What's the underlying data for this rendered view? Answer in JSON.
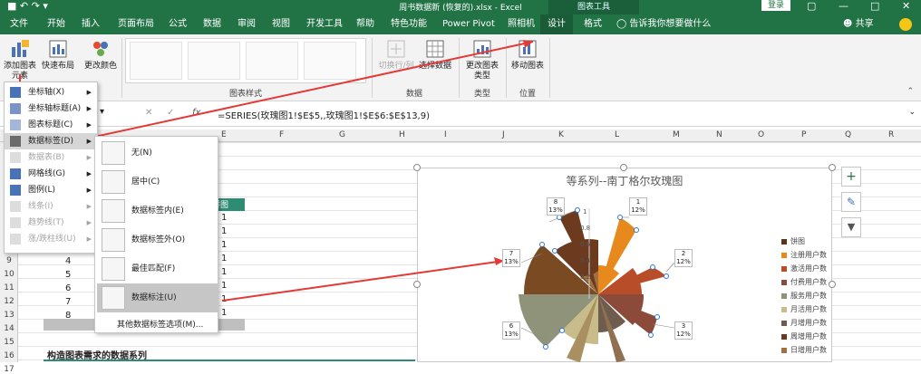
{
  "window": {
    "title": "周书数据新 (恢复的).xlsx - Excel",
    "context_tab": "图表工具",
    "login_label": "登录"
  },
  "menu_tabs": [
    "文件",
    "开始",
    "插入",
    "页面布局",
    "公式",
    "数据",
    "审阅",
    "视图",
    "开发工具",
    "帮助",
    "特色功能",
    "Power Pivot",
    "照相机",
    "设计",
    "格式"
  ],
  "active_tab": "设计",
  "tell_me": "告诉我你想要做什么",
  "share": "共享",
  "ribbon": {
    "add_element": "添加图表元素",
    "quick_layout": "快速布局",
    "change_colors": "更改颜色",
    "chart_styles_group": "图表样式",
    "switch_row_col": "切换行/列",
    "select_data": "选择数据",
    "data_group": "数据",
    "change_type": "更改图表类型",
    "type_group": "类型",
    "move_chart": "移动图表",
    "location_group": "位置"
  },
  "formula": {
    "fx": "fx",
    "text": "=SERIES(玫瑰图1!$E$5,,玫瑰图1!$E$6:$E$13,9)"
  },
  "columns": [
    "E",
    "F",
    "G",
    "H",
    "I",
    "J",
    "K",
    "L",
    "M",
    "N",
    "O",
    "P",
    "Q",
    "R"
  ],
  "rows": [
    "9",
    "10",
    "11",
    "12",
    "13",
    "14",
    "15",
    "16",
    "17"
  ],
  "cells": {
    "values": [
      "4",
      "5",
      "6",
      "7",
      "8"
    ],
    "ones": [
      "1",
      "1",
      "1",
      "1",
      "1",
      "1",
      "1",
      "1"
    ],
    "header_fragment": "饼图",
    "section_title": "构造图表需求的数据系列"
  },
  "add_element_menu": [
    {
      "label": "坐标轴(X)",
      "disabled": false
    },
    {
      "label": "坐标轴标题(A)",
      "disabled": false
    },
    {
      "label": "图表标题(C)",
      "disabled": false
    },
    {
      "label": "数据标签(D)",
      "disabled": false,
      "active": true
    },
    {
      "label": "数据表(B)",
      "disabled": true
    },
    {
      "label": "网格线(G)",
      "disabled": false
    },
    {
      "label": "图例(L)",
      "disabled": false
    },
    {
      "label": "线条(I)",
      "disabled": true
    },
    {
      "label": "趋势线(T)",
      "disabled": true
    },
    {
      "label": "涨/跌柱线(U)",
      "disabled": true
    }
  ],
  "data_label_submenu": [
    {
      "label": "无(N)"
    },
    {
      "label": "居中(C)"
    },
    {
      "label": "数据标签内(E)"
    },
    {
      "label": "数据标签外(O)"
    },
    {
      "label": "最佳匹配(F)"
    },
    {
      "label": "数据标注(U)",
      "active": true
    }
  ],
  "data_label_more": "其他数据标签选项(M)...",
  "chart": {
    "title": "等系列--南丁格尔玫瑰图",
    "legend": [
      {
        "name": "饼图",
        "color": "#5a3418"
      },
      {
        "name": "注册用户数",
        "color": "#e8891e"
      },
      {
        "name": "激活用户数",
        "color": "#b84d2a"
      },
      {
        "name": "付费用户数",
        "color": "#8b4a3a"
      },
      {
        "name": "服务用户数",
        "color": "#8f937a"
      },
      {
        "name": "月活用户数",
        "color": "#c8bd8a"
      },
      {
        "name": "月增用户数",
        "color": "#6e5c4f"
      },
      {
        "name": "周增用户数",
        "color": "#6b3a1f"
      },
      {
        "name": "日增用户数",
        "color": "#a07040"
      }
    ],
    "ticks": [
      "1",
      "0.8",
      "0.6",
      "0.4",
      "0.2"
    ],
    "callouts": [
      {
        "num": "8",
        "pct": "13%"
      },
      {
        "num": "1",
        "pct": "12%"
      },
      {
        "num": "7",
        "pct": "13%"
      },
      {
        "num": "2",
        "pct": "12%"
      },
      {
        "num": "6",
        "pct": "13%"
      },
      {
        "num": "3",
        "pct": "12%"
      }
    ]
  }
}
